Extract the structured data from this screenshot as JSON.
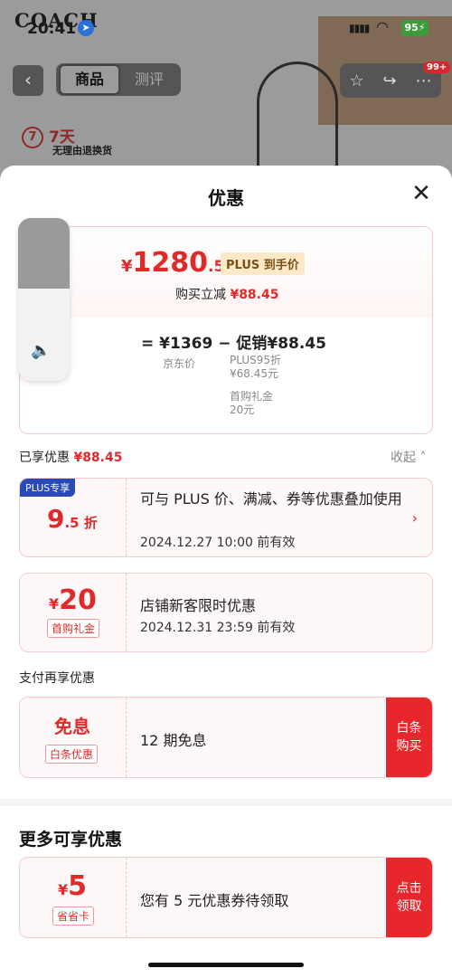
{
  "status_bar": {
    "time": "20:41",
    "battery": "95"
  },
  "background": {
    "brand": "COACH",
    "tabs": [
      "商品",
      "测评"
    ],
    "cart_badge": "99+",
    "return_days": "7天",
    "return_text": "无理由退换货"
  },
  "sheet": {
    "title": "优惠",
    "price_card": {
      "currency": "¥",
      "price_int": "1280",
      "price_dec": ".55",
      "plus_tag": "PLUS 到手价",
      "instant_save_label": "购买立减",
      "instant_save_amount": "¥88.45",
      "formula": "= ¥1369 − 促销¥88.45",
      "jd_price_label": "京东价",
      "detail_plus_label": "PLUS95折",
      "detail_plus_amount": "¥68.45元",
      "detail_gift_label": "首购礼金",
      "detail_gift_amount": "20元"
    },
    "enjoyed_label": "已享优惠",
    "enjoyed_amount": "¥88.45",
    "collapse_label": "收起",
    "coupons": [
      {
        "badge": "PLUS专享",
        "big": "9",
        "small": ".5 折",
        "title": "可与 PLUS 价、满减、券等优惠叠加使用",
        "sub": "2024.12.27 10:00 前有效"
      },
      {
        "currency": "¥",
        "amount": "20",
        "pill": "首购礼金",
        "title": "店铺新客限时优惠",
        "sub": "2024.12.31 23:59 前有效"
      }
    ],
    "pay_section_label": "支付再享优惠",
    "pay_coupon": {
      "big": "免息",
      "pill": "白条优惠",
      "title": "12 期免息",
      "button": "白条\n购买"
    },
    "more_title": "更多可享优惠",
    "more_coupon": {
      "currency": "¥",
      "amount": "5",
      "pill": "省省卡",
      "title": "您有 5 元优惠券待领取",
      "button": "点击\n领取"
    }
  }
}
